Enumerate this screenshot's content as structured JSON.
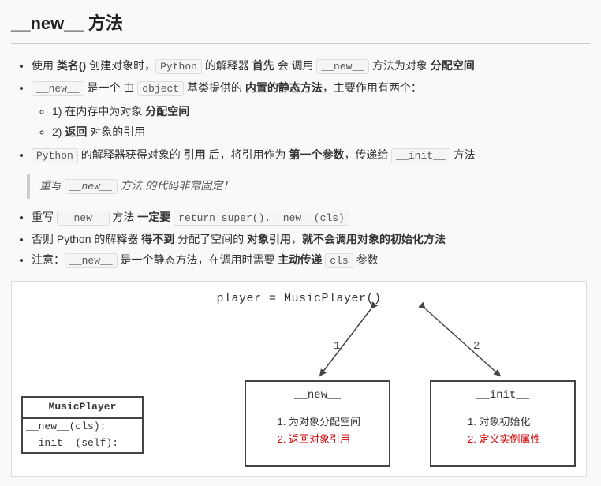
{
  "title": "__new__ 方法",
  "bullets": {
    "b1_a": "使用 ",
    "b1_b": "类名()",
    "b1_c": " 创建对象时，",
    "b1_code1": "Python",
    "b1_d": " 的解释器 ",
    "b1_e": "首先",
    "b1_f": " 会 调用 ",
    "b1_code2": "__new__",
    "b1_g": " 方法为对象 ",
    "b1_h": "分配空间",
    "b2_code1": "__new__",
    "b2_a": " 是一个 由 ",
    "b2_code2": "object",
    "b2_b": " 基类提供的 ",
    "b2_c": "内置的静态方法",
    "b2_d": "，主要作用有两个：",
    "sub1_a": "1) 在内存中为对象 ",
    "sub1_b": "分配空间",
    "sub2_a": "2) ",
    "sub2_b": "返回",
    "sub2_c": " 对象的引用",
    "b3_code1": "Python",
    "b3_a": " 的解释器获得对象的 ",
    "b3_b": "引用",
    "b3_c": " 后，将引用作为 ",
    "b3_d": "第一个参数",
    "b3_e": "，传递给 ",
    "b3_code2": "__init__",
    "b3_f": " 方法"
  },
  "quote": {
    "a": "重写 ",
    "code": "__new__",
    "b": " 方法 的代码非常固定！"
  },
  "bullets2": {
    "b4_a": "重写 ",
    "b4_code1": "__new__",
    "b4_b": " 方法 ",
    "b4_c": "一定要 ",
    "b4_code2": "return super().__new__(cls)",
    "b5_a": "否则 Python 的解释器 ",
    "b5_b": "得不到",
    "b5_c": " 分配了空间的 ",
    "b5_d": "对象引用",
    "b5_e": "，",
    "b5_f": "就不会调用对象的初始化方法",
    "b6_a": "注意：",
    "b6_code1": "__new__",
    "b6_b": " 是一个静态方法，在调用时需要 ",
    "b6_c": "主动传递 ",
    "b6_code2": "cls",
    "b6_d": " 参数"
  },
  "diagram": {
    "top": "player = MusicPlayer()",
    "uml_title": "MusicPlayer",
    "uml_line1": "__new__(cls):",
    "uml_line2": "__init__(self):",
    "edge1": "1",
    "edge2": "2",
    "new_title": "__new__",
    "new_item1": "为对象分配空间",
    "new_item2": "返回对象引用",
    "init_title": "__init__",
    "init_item1": "对象初始化",
    "init_item2": "定义实例属性"
  }
}
